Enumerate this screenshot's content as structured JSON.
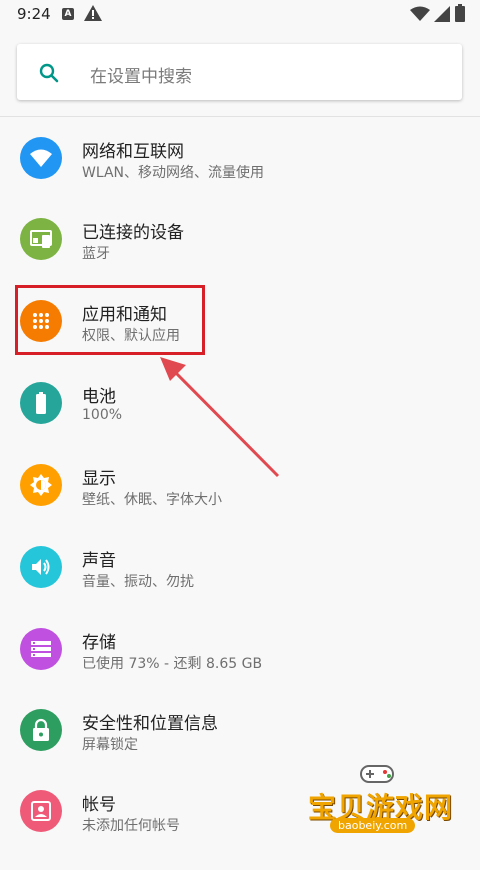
{
  "status_bar": {
    "time": "9:24",
    "badge_letter": "A"
  },
  "search": {
    "placeholder": "在设置中搜索"
  },
  "settings_items": [
    {
      "title": "网络和互联网",
      "subtitle": "WLAN、移动网络、流量使用",
      "color": "#2196f3",
      "icon": "wifi-icon"
    },
    {
      "title": "已连接的设备",
      "subtitle": "蓝牙",
      "color": "#7cb342",
      "icon": "devices-icon"
    },
    {
      "title": "应用和通知",
      "subtitle": "权限、默认应用",
      "color": "#f57c00",
      "icon": "apps-icon"
    },
    {
      "title": "电池",
      "subtitle": "100%",
      "color": "#26a69a",
      "icon": "battery-icon"
    },
    {
      "title": "显示",
      "subtitle": "壁纸、休眠、字体大小",
      "color": "#ffa000",
      "icon": "brightness-icon"
    },
    {
      "title": "声音",
      "subtitle": "音量、振动、勿扰",
      "color": "#26c6da",
      "icon": "volume-icon"
    },
    {
      "title": "存储",
      "subtitle": "已使用 73% - 还剩 8.65 GB",
      "color": "#c050e0",
      "icon": "storage-icon"
    },
    {
      "title": "安全性和位置信息",
      "subtitle": "屏幕锁定",
      "color": "#2e9e60",
      "icon": "lock-icon"
    },
    {
      "title": "帐号",
      "subtitle": "未添加任何帐号",
      "color": "#ef5a78",
      "icon": "account-icon"
    }
  ],
  "watermark": {
    "name": "宝贝游戏网",
    "url": "baobeiy.com"
  },
  "colors": {
    "highlight": "#d61f26",
    "accent": "#009688"
  }
}
